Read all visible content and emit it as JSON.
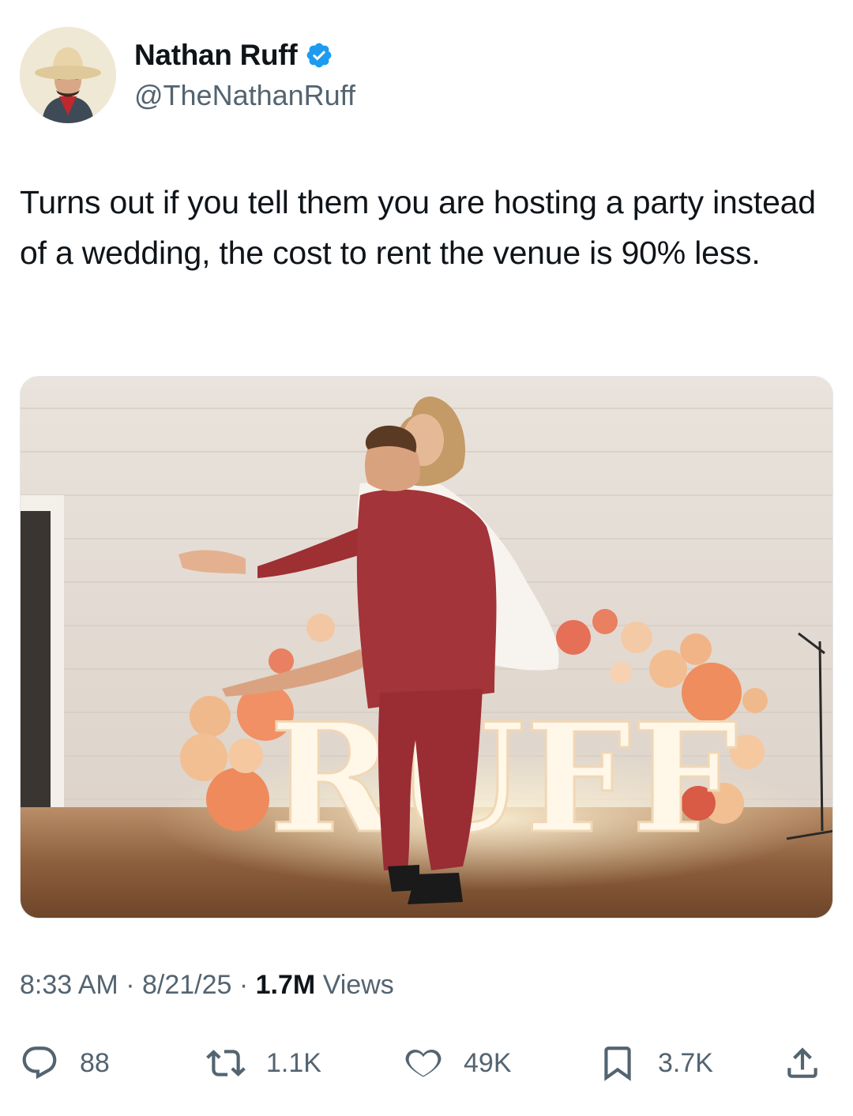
{
  "author": {
    "display_name": "Nathan Ruff",
    "handle": "@TheNathanRuff",
    "verified": true,
    "verified_color": "#1d9bf0",
    "avatar_icon": "cowboy-avatar-icon"
  },
  "tweet": {
    "text": "Turns out if you tell them you are hosting a party instead of a wedding, the cost to rent the venue is 90% less."
  },
  "media": {
    "sign_text": "RUFF"
  },
  "meta": {
    "time": "8:33 AM",
    "separator": " · ",
    "date": "8/21/25",
    "views_count": "1.7M",
    "views_label": "Views"
  },
  "actions": {
    "reply": {
      "icon": "reply-icon",
      "count": "88"
    },
    "retweet": {
      "icon": "retweet-icon",
      "count": "1.1K"
    },
    "like": {
      "icon": "heart-icon",
      "count": "49K"
    },
    "bookmark": {
      "icon": "bookmark-icon",
      "count": "3.7K"
    },
    "share": {
      "icon": "share-icon"
    }
  },
  "colors": {
    "text_primary": "#0f1419",
    "text_secondary": "#536471",
    "accent": "#1d9bf0"
  }
}
